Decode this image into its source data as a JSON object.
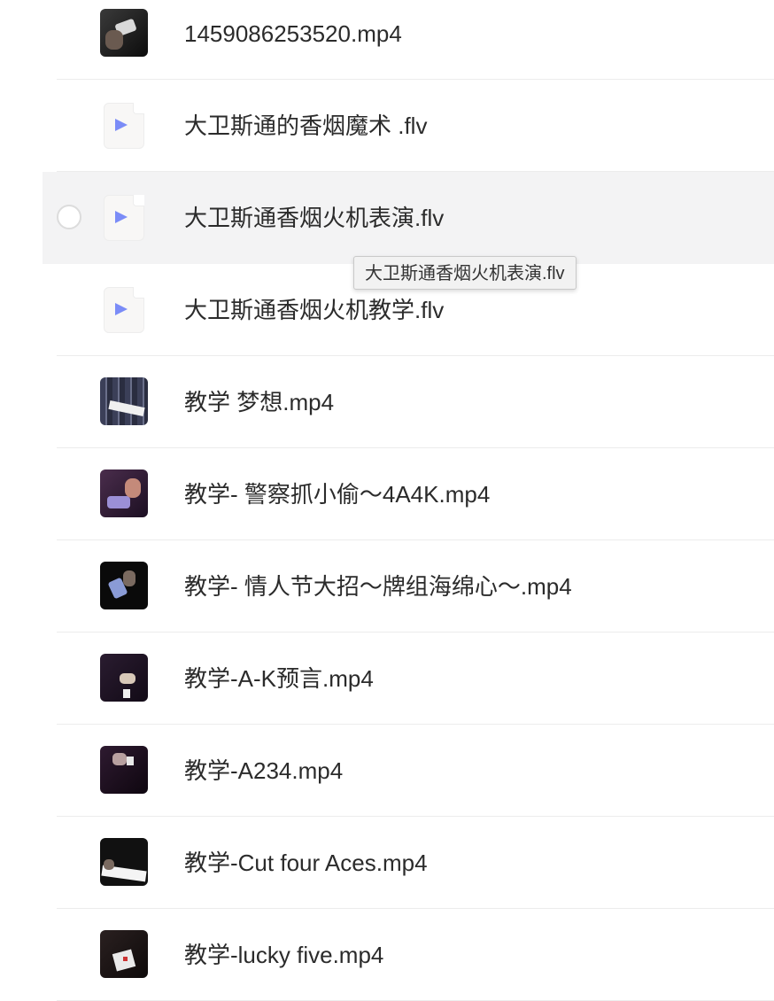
{
  "files": [
    {
      "name": "1459086253520.mp4",
      "thumb": "video-thumbnail",
      "hovered": false
    },
    {
      "name": "大卫斯通的香烟魔术 .flv",
      "thumb": "video-file-icon",
      "hovered": false
    },
    {
      "name": "大卫斯通香烟火机表演.flv",
      "thumb": "video-file-icon",
      "hovered": true
    },
    {
      "name": "大卫斯通香烟火机教学.flv",
      "thumb": "video-file-icon",
      "hovered": false
    },
    {
      "name": "教学 梦想.mp4",
      "thumb": "video-thumbnail",
      "hovered": false
    },
    {
      "name": "教学- 警察抓小偷～4A4K.mp4",
      "thumb": "video-thumbnail",
      "hovered": false
    },
    {
      "name": "教学- 情人节大招～牌组海绵心～.mp4",
      "thumb": "video-thumbnail",
      "hovered": false
    },
    {
      "name": "教学-A-K预言.mp4",
      "thumb": "video-thumbnail",
      "hovered": false
    },
    {
      "name": "教学-A234.mp4",
      "thumb": "video-thumbnail",
      "hovered": false
    },
    {
      "name": "教学-Cut four Aces.mp4",
      "thumb": "video-thumbnail",
      "hovered": false
    },
    {
      "name": "教学-lucky five.mp4",
      "thumb": "video-thumbnail",
      "hovered": false
    }
  ],
  "tooltip": {
    "text": "大卫斯通香烟火机表演.flv"
  },
  "colors": {
    "hover_bg": "#f3f3f4",
    "play_icon": "#7b8cf7",
    "text": "#2b2b2b"
  }
}
